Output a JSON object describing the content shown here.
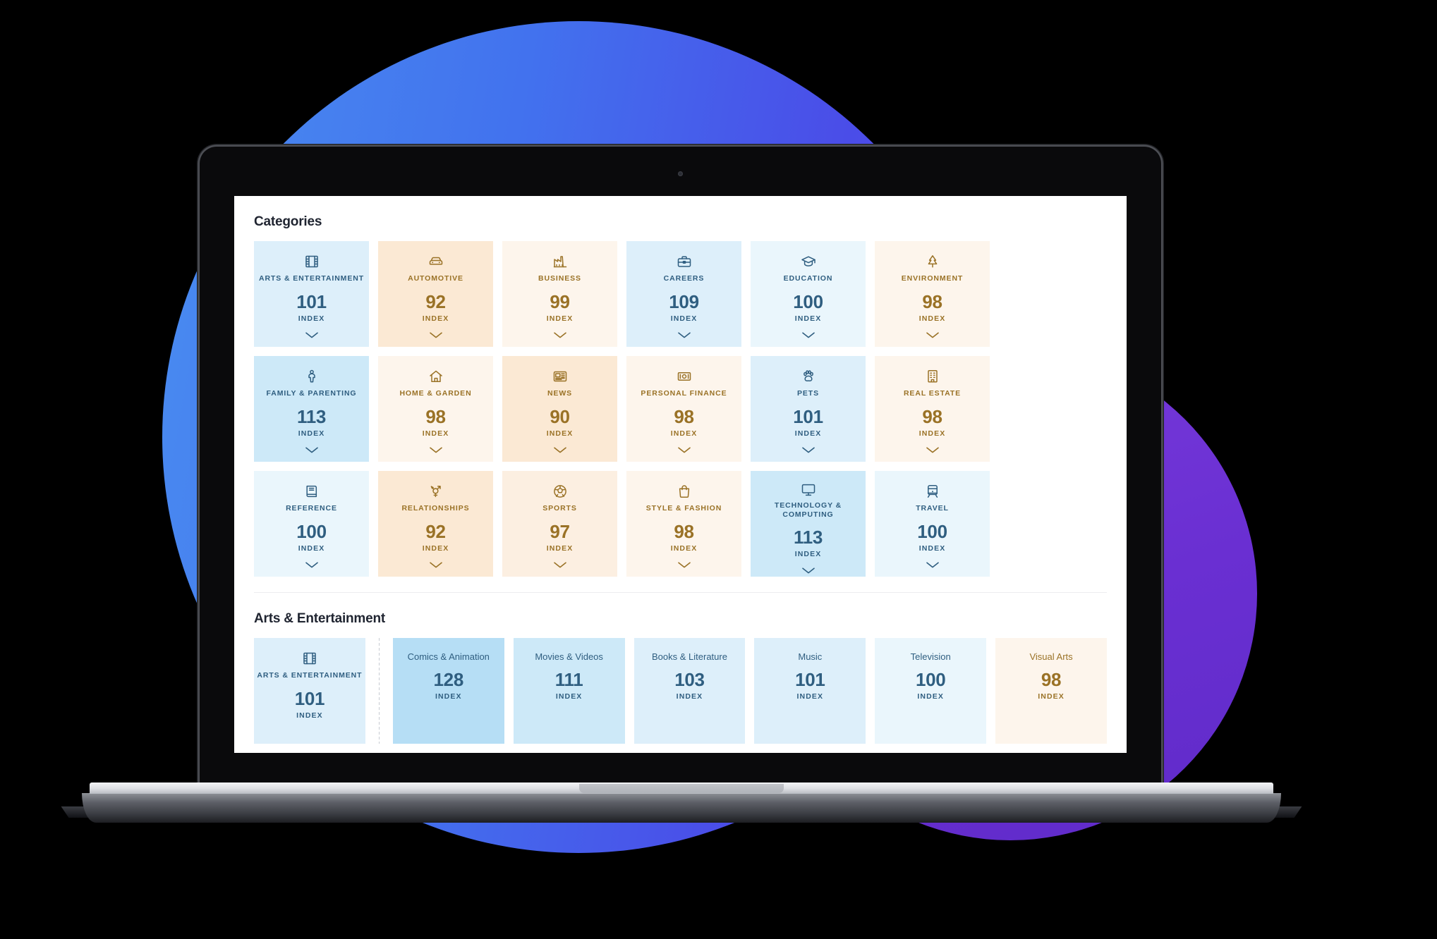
{
  "theme": {
    "blue_text": "#2f5e80",
    "gold_text": "#9a7226",
    "blue_tints": [
      "#eaf6fc",
      "#ddeffa",
      "#cde9f8",
      "#b6def5"
    ],
    "gold_tints": [
      "#fdf5ec",
      "#fcefe1",
      "#fbe9d4"
    ],
    "blob_blue": "#4272ee",
    "blob_purple": "#6a2fd2",
    "heading": "#1f2430"
  },
  "index_label": "INDEX",
  "categories_section": {
    "title": "Categories",
    "cards": [
      {
        "label": "Arts & Entertainment",
        "value": "101",
        "tone": "blue",
        "icon": "film-strip-icon"
      },
      {
        "label": "Automotive",
        "value": "92",
        "tone": "gold",
        "icon": "car-icon"
      },
      {
        "label": "Business",
        "value": "99",
        "tone": "gold",
        "icon": "factory-icon"
      },
      {
        "label": "Careers",
        "value": "109",
        "tone": "blue",
        "icon": "briefcase-icon"
      },
      {
        "label": "Education",
        "value": "100",
        "tone": "blue",
        "icon": "graduation-cap-icon"
      },
      {
        "label": "Environment",
        "value": "98",
        "tone": "gold",
        "icon": "tree-icon"
      },
      {
        "label": "Family & Parenting",
        "value": "113",
        "tone": "blue",
        "icon": "parent-child-icon"
      },
      {
        "label": "Home & Garden",
        "value": "98",
        "tone": "gold",
        "icon": "house-icon"
      },
      {
        "label": "News",
        "value": "90",
        "tone": "gold",
        "icon": "newspaper-icon"
      },
      {
        "label": "Personal Finance",
        "value": "98",
        "tone": "gold",
        "icon": "banknote-icon"
      },
      {
        "label": "Pets",
        "value": "101",
        "tone": "blue",
        "icon": "paw-print-icon"
      },
      {
        "label": "Real Estate",
        "value": "98",
        "tone": "gold",
        "icon": "building-icon"
      },
      {
        "label": "Reference",
        "value": "100",
        "tone": "blue",
        "icon": "book-icon"
      },
      {
        "label": "Relationships",
        "value": "92",
        "tone": "gold",
        "icon": "gender-symbols-icon"
      },
      {
        "label": "Sports",
        "value": "97",
        "tone": "gold",
        "icon": "soccer-ball-icon"
      },
      {
        "label": "Style & Fashion",
        "value": "98",
        "tone": "gold",
        "icon": "shopping-bag-icon"
      },
      {
        "label": "Technology & Computing",
        "value": "113",
        "tone": "blue",
        "icon": "monitor-icon"
      },
      {
        "label": "Travel",
        "value": "100",
        "tone": "blue",
        "icon": "train-icon"
      }
    ]
  },
  "detail_section": {
    "title": "Arts & Entertainment",
    "parent_card": {
      "label": "Arts & Entertainment",
      "value": "101",
      "tone": "blue",
      "icon": "film-strip-icon"
    },
    "cards": [
      {
        "label": "Comics & Animation",
        "value": "128",
        "tone": "blue"
      },
      {
        "label": "Movies & Videos",
        "value": "111",
        "tone": "blue"
      },
      {
        "label": "Books & Literature",
        "value": "103",
        "tone": "blue"
      },
      {
        "label": "Music",
        "value": "101",
        "tone": "blue"
      },
      {
        "label": "Television",
        "value": "100",
        "tone": "blue"
      },
      {
        "label": "Visual Arts",
        "value": "98",
        "tone": "gold"
      }
    ]
  }
}
